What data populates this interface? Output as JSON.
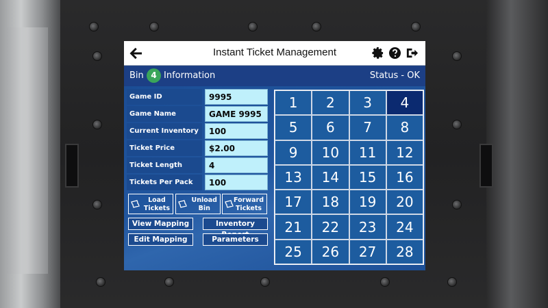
{
  "header": {
    "title": "Instant Ticket Management",
    "icons": [
      "back-arrow-icon",
      "gear-icon",
      "help-icon",
      "logout-icon"
    ]
  },
  "info_bar": {
    "bin_label": "Bin",
    "bin_number": "4",
    "info_label": "Information",
    "status": "Status - OK"
  },
  "fields": [
    {
      "label": "Game ID",
      "value": "9995"
    },
    {
      "label": "Game Name",
      "value": "GAME 9995"
    },
    {
      "label": "Current Inventory",
      "value": "100"
    },
    {
      "label": "Ticket Price",
      "value": "$2.00"
    },
    {
      "label": "Ticket Length",
      "value": "4"
    },
    {
      "label": "Tickets Per Pack",
      "value": "100"
    }
  ],
  "actions": {
    "load": [
      "Load",
      "Tickets"
    ],
    "unload": [
      "Unload",
      "Bin"
    ],
    "forward": [
      "Forward",
      "Tickets"
    ],
    "view_mapping": "View Mapping",
    "edit_mapping": "Edit Mapping",
    "inventory_report": "Inventory Report",
    "parameters": "Parameters"
  },
  "bins": [
    "1",
    "2",
    "3",
    "4",
    "5",
    "6",
    "7",
    "8",
    "9",
    "10",
    "11",
    "12",
    "13",
    "14",
    "15",
    "16",
    "17",
    "18",
    "19",
    "20",
    "21",
    "22",
    "23",
    "24",
    "25",
    "26",
    "27",
    "28"
  ],
  "selected_bin": "4",
  "colors": {
    "screen_bg": "#1c4f97",
    "value_bg": "#bff0fb",
    "bin_badge": "#3aa55a",
    "selected_cell": "#0b2a70"
  }
}
